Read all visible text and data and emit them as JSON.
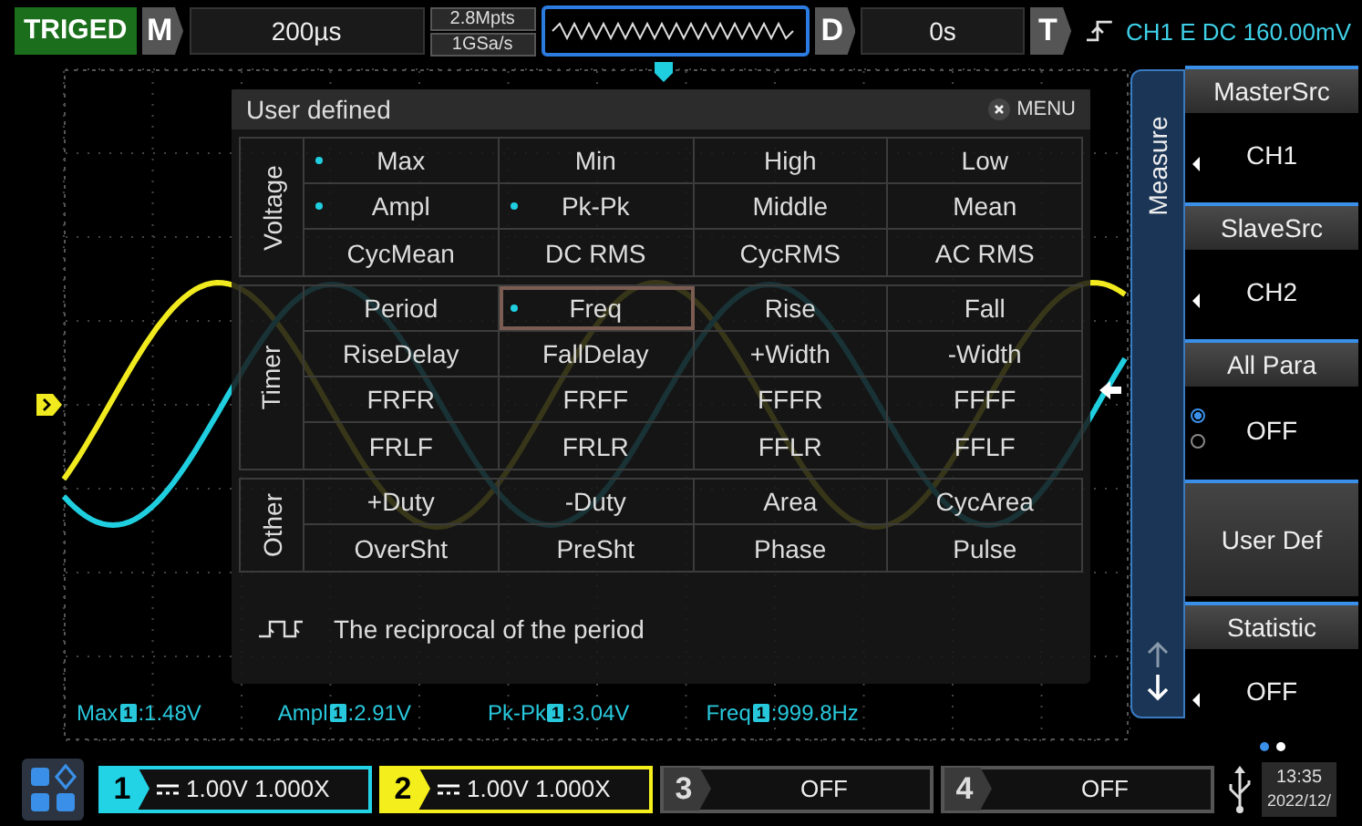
{
  "status": "TRIGED",
  "timebase": {
    "key": "M",
    "value": "200µs"
  },
  "memory": {
    "depth": "2.8Mpts",
    "rate": "1GSa/s"
  },
  "delay": {
    "key": "D",
    "value": "0s"
  },
  "trigger": {
    "key": "T",
    "info": "CH1 E DC 160.00mV"
  },
  "dialog": {
    "title": "User defined",
    "close": "MENU",
    "description": "The reciprocal of the period",
    "groups": [
      {
        "name": "Voltage",
        "rows": [
          [
            {
              "label": "Max",
              "marked": true,
              "selected": false
            },
            {
              "label": "Min",
              "marked": false,
              "selected": false
            },
            {
              "label": "High",
              "marked": false,
              "selected": false
            },
            {
              "label": "Low",
              "marked": false,
              "selected": false
            }
          ],
          [
            {
              "label": "Ampl",
              "marked": true,
              "selected": false
            },
            {
              "label": "Pk-Pk",
              "marked": true,
              "selected": false
            },
            {
              "label": "Middle",
              "marked": false,
              "selected": false
            },
            {
              "label": "Mean",
              "marked": false,
              "selected": false
            }
          ],
          [
            {
              "label": "CycMean",
              "marked": false,
              "selected": false
            },
            {
              "label": "DC RMS",
              "marked": false,
              "selected": false
            },
            {
              "label": "CycRMS",
              "marked": false,
              "selected": false
            },
            {
              "label": "AC RMS",
              "marked": false,
              "selected": false
            }
          ]
        ]
      },
      {
        "name": "Timer",
        "rows": [
          [
            {
              "label": "Period",
              "marked": false,
              "selected": false
            },
            {
              "label": "Freq",
              "marked": true,
              "selected": true
            },
            {
              "label": "Rise",
              "marked": false,
              "selected": false
            },
            {
              "label": "Fall",
              "marked": false,
              "selected": false
            }
          ],
          [
            {
              "label": "RiseDelay",
              "marked": false,
              "selected": false
            },
            {
              "label": "FallDelay",
              "marked": false,
              "selected": false
            },
            {
              "label": "+Width",
              "marked": false,
              "selected": false
            },
            {
              "label": "-Width",
              "marked": false,
              "selected": false
            }
          ],
          [
            {
              "label": "FRFR",
              "marked": false,
              "selected": false
            },
            {
              "label": "FRFF",
              "marked": false,
              "selected": false
            },
            {
              "label": "FFFR",
              "marked": false,
              "selected": false
            },
            {
              "label": "FFFF",
              "marked": false,
              "selected": false
            }
          ],
          [
            {
              "label": "FRLF",
              "marked": false,
              "selected": false
            },
            {
              "label": "FRLR",
              "marked": false,
              "selected": false
            },
            {
              "label": "FFLR",
              "marked": false,
              "selected": false
            },
            {
              "label": "FFLF",
              "marked": false,
              "selected": false
            }
          ]
        ]
      },
      {
        "name": "Other",
        "rows": [
          [
            {
              "label": "+Duty",
              "marked": false,
              "selected": false
            },
            {
              "label": "-Duty",
              "marked": false,
              "selected": false
            },
            {
              "label": "Area",
              "marked": false,
              "selected": false
            },
            {
              "label": "CycArea",
              "marked": false,
              "selected": false
            }
          ],
          [
            {
              "label": "OverSht",
              "marked": false,
              "selected": false
            },
            {
              "label": "PreSht",
              "marked": false,
              "selected": false
            },
            {
              "label": "Phase",
              "marked": false,
              "selected": false
            },
            {
              "label": "Pulse",
              "marked": false,
              "selected": false
            }
          ]
        ]
      }
    ]
  },
  "readouts": [
    {
      "name": "Max",
      "channel": "1",
      "value": ":1.48V"
    },
    {
      "name": "Ampl",
      "channel": "1",
      "value": ":2.91V"
    },
    {
      "name": "Pk-Pk",
      "channel": "1",
      "value": ":3.04V"
    },
    {
      "name": "Freq",
      "channel": "1",
      "value": ":999.8Hz"
    }
  ],
  "side_tab": "Measure",
  "softkeys": [
    {
      "kind": "select",
      "title": "MasterSrc",
      "value": "CH1"
    },
    {
      "kind": "select",
      "title": "SlaveSrc",
      "value": "CH2"
    },
    {
      "kind": "radio",
      "title": "All Para",
      "value": "OFF",
      "radios": [
        {
          "selected": true
        },
        {
          "selected": false
        }
      ]
    },
    {
      "kind": "button",
      "title": "User Def"
    },
    {
      "kind": "select",
      "title": "Statistic",
      "value": "OFF"
    }
  ],
  "page_dots": [
    {
      "selected": true
    },
    {
      "selected": false
    }
  ],
  "channels": [
    {
      "number": "1",
      "on": true,
      "color": "#22d3e6",
      "reading": "1.00V 1.000X"
    },
    {
      "number": "2",
      "on": true,
      "color": "#f4ee1c",
      "reading": "1.00V 1.000X"
    },
    {
      "number": "3",
      "on": false,
      "reading": "OFF"
    },
    {
      "number": "4",
      "on": false,
      "reading": "OFF"
    }
  ],
  "clock": {
    "time": "13:35",
    "date": "2022/12/"
  }
}
